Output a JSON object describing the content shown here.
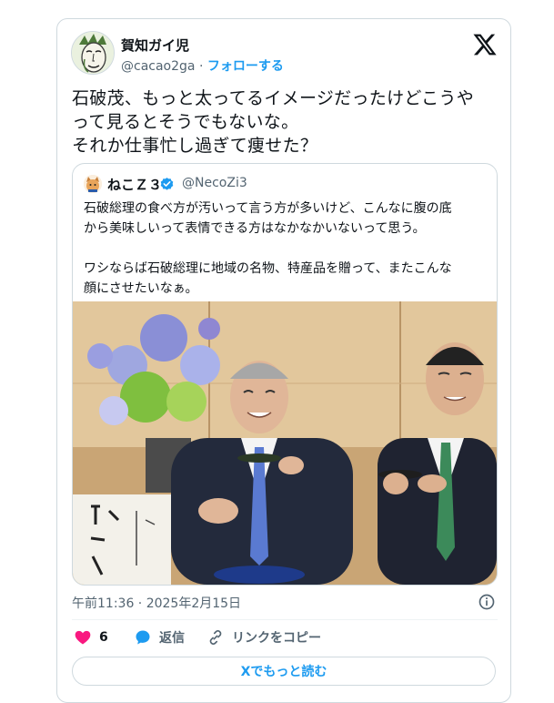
{
  "author": {
    "name": "賀知ガイ児",
    "handle": "@cacao2ga",
    "separator": "·",
    "follow_label": "フォローする"
  },
  "tweet": {
    "text": "石破茂、もっと太ってるイメージだったけどこうや\nって見るとそうでもないな。\nそれか仕事忙し過ぎて痩せた？"
  },
  "quote": {
    "name": "ねこＺ３",
    "handle": "@NecoZi3",
    "text": "石破総理の食べ方が汚いって言う方が多いけど、こんなに腹の底\nから美味しいって表情できる方はなかなかいないって思う。\n\nワシならば石破総理に地域の名物、特産品を贈って、またこんな\n顔にさせたいなぁ。",
    "verified_color": "#1d9bf0"
  },
  "meta": {
    "timestamp": "午前11:36 · 2025年2月15日"
  },
  "actions": {
    "likes_count": "6",
    "reply_label": "返信",
    "copy_link_label": "リンクをコピー",
    "read_more_label": "Xでもっと読む"
  },
  "colors": {
    "accent": "#1d9bf0",
    "like": "#f91880",
    "text": "#0f1419",
    "secondary": "#536471",
    "border": "#cfd9de"
  },
  "icons": [
    "x-logo-icon",
    "verified-badge-icon",
    "info-icon",
    "heart-icon",
    "reply-bubble-icon",
    "link-icon"
  ]
}
